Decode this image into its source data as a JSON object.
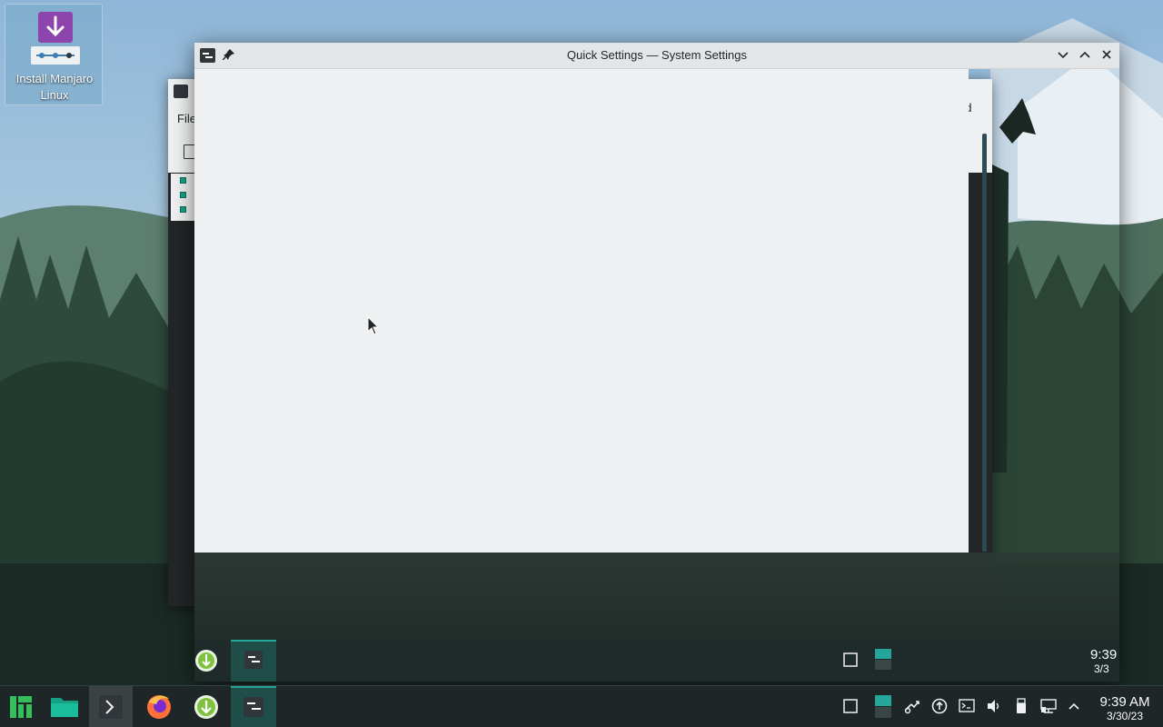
{
  "desktop": {
    "install_icon": {
      "label": "Install Manjaro Linux",
      "icon": "install-download-icon",
      "color": "#8e44ad"
    }
  },
  "background_window": {
    "menu_first": "File",
    "menu_fragment": "nd"
  },
  "main_window": {
    "title": "Quick Settings — System Settings",
    "buttons": {
      "minimize": "chevron-down-icon",
      "maximize": "chevron-up-icon",
      "close": "close-icon"
    }
  },
  "taskbar": {
    "launchers": [
      {
        "name": "manjaro-menu-icon",
        "color": "#35bf5c"
      },
      {
        "name": "folder-icon",
        "color": "#16a085"
      },
      {
        "name": "terminal-icon",
        "color": "#eff0f1"
      },
      {
        "name": "firefox-icon",
        "color": "#ff7139"
      },
      {
        "name": "install-download-icon",
        "color": "#7fc241"
      },
      {
        "name": "system-settings-icon",
        "color": "#eff0f1"
      }
    ],
    "tray": [
      "show-desktop-icon",
      "pager-icon",
      "kde-connect-icon",
      "updates-icon",
      "terminal-tray-icon",
      "volume-icon",
      "usb-icon",
      "network-icon",
      "expand-tray-icon"
    ],
    "clock": {
      "time": "9:39 AM",
      "date": "3/30/23"
    }
  },
  "mirror_clock": {
    "time": "9:39",
    "date": "3/3"
  },
  "colors": {
    "accent": "#26a69a",
    "panel": "#1e2627",
    "window_bg": "#eff0f1"
  }
}
